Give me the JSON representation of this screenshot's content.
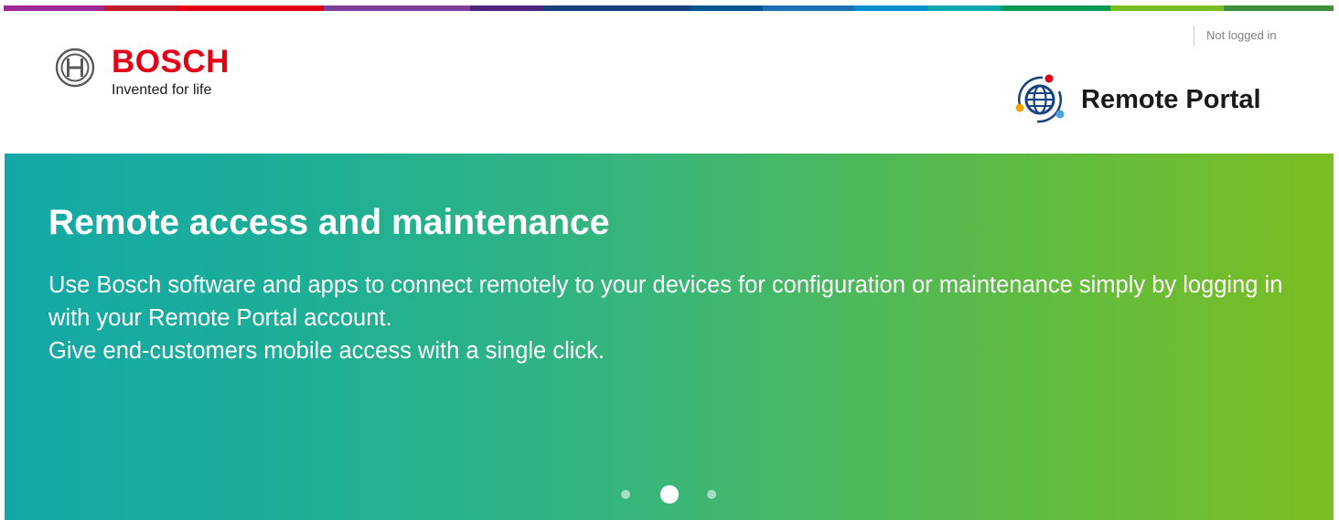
{
  "supergraphic_colors": [
    "#9e2896",
    "#e20015",
    "#e20015",
    "#7d3f98",
    "#50237f",
    "#18427d",
    "#005691",
    "#008ecf",
    "#00a8b0",
    "#009a56",
    "#78be20",
    "#3e8e3a"
  ],
  "header": {
    "brand_name": "BOSCH",
    "brand_tagline": "Invented for life",
    "login_status": "Not logged in",
    "portal_title": "Remote Portal"
  },
  "hero": {
    "title": "Remote access and maintenance",
    "paragraph_1": "Use Bosch software and apps to connect remotely to your devices for configuration or maintenance simply by logging in with your Remote Portal account.",
    "paragraph_2": "Give end-customers mobile access with a single click.",
    "slide_count": 3,
    "active_slide": 2
  },
  "colors": {
    "brand_red": "#e20015",
    "hero_gradient_start": "#13a8a8",
    "hero_gradient_end": "#7bbe22",
    "text_dark": "#1a1a1a",
    "status_gray": "#7d8389"
  },
  "icons": {
    "brand_logo": "bosch-armature-icon",
    "portal_logo": "globe-network-icon"
  }
}
